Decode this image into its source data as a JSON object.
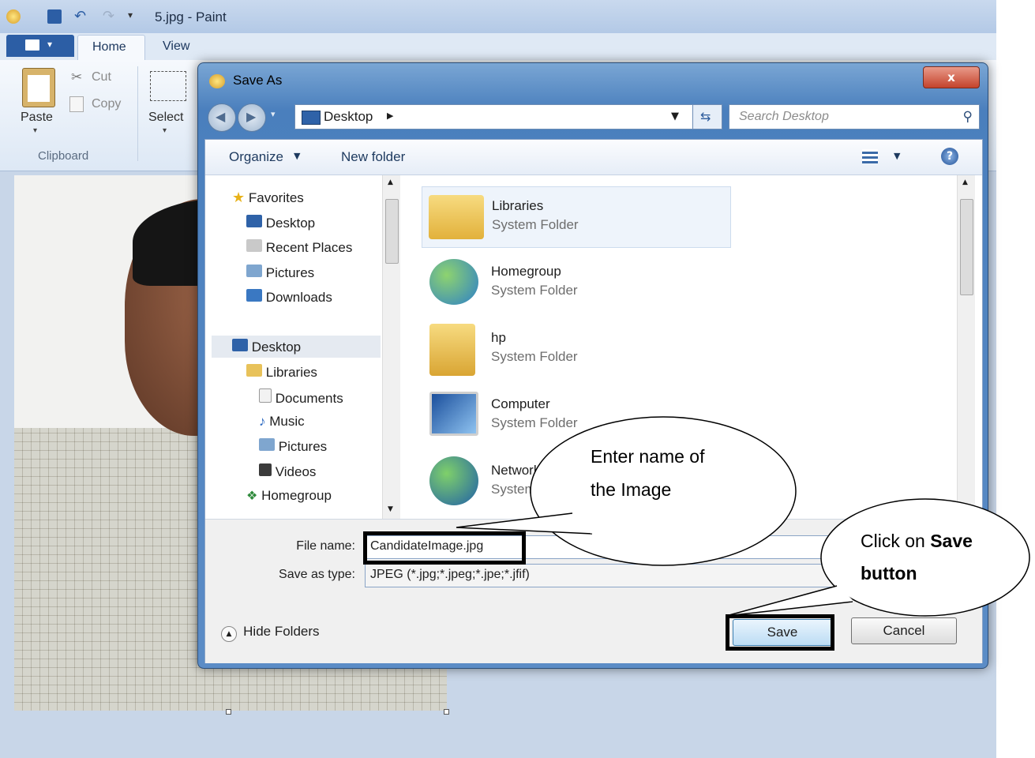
{
  "paint": {
    "title": "5.jpg - Paint",
    "tabs": [
      "Home",
      "View"
    ],
    "ribbon": {
      "paste": "Paste",
      "cut": "Cut",
      "copy": "Copy",
      "select": "Select",
      "clipboard_group": "Clipboard"
    }
  },
  "dialog": {
    "title": "Save As",
    "close": "x",
    "address": "Desktop",
    "search_placeholder": "Search Desktop",
    "toolbar": {
      "organize": "Organize",
      "new_folder": "New folder"
    },
    "nav": {
      "favorites": "Favorites",
      "favorites_items": [
        "Desktop",
        "Recent Places",
        "Pictures",
        "Downloads"
      ],
      "desktop": "Desktop",
      "libraries": "Libraries",
      "library_items": [
        "Documents",
        "Music",
        "Pictures",
        "Videos"
      ],
      "homegroup": "Homegroup"
    },
    "files": [
      {
        "name": "Libraries",
        "type": "System Folder"
      },
      {
        "name": "Homegroup",
        "type": "System Folder"
      },
      {
        "name": "hp",
        "type": "System Folder"
      },
      {
        "name": "Computer",
        "type": "System Folder"
      },
      {
        "name": "Network",
        "type": "System"
      }
    ],
    "file_name_label": "File name:",
    "file_name_value": "CandidateImage.jpg",
    "save_type_label": "Save as type:",
    "save_type_value": "JPEG (*.jpg;*.jpeg;*.jpe;*.jfif)",
    "hide_folders": "Hide Folders",
    "save": "Save",
    "cancel": "Cancel"
  },
  "callouts": {
    "name_line1": "Enter name of",
    "name_line2": "the Image",
    "save_line1_pre": "Click on ",
    "save_line1_bold": "Save",
    "save_line2": "button"
  }
}
